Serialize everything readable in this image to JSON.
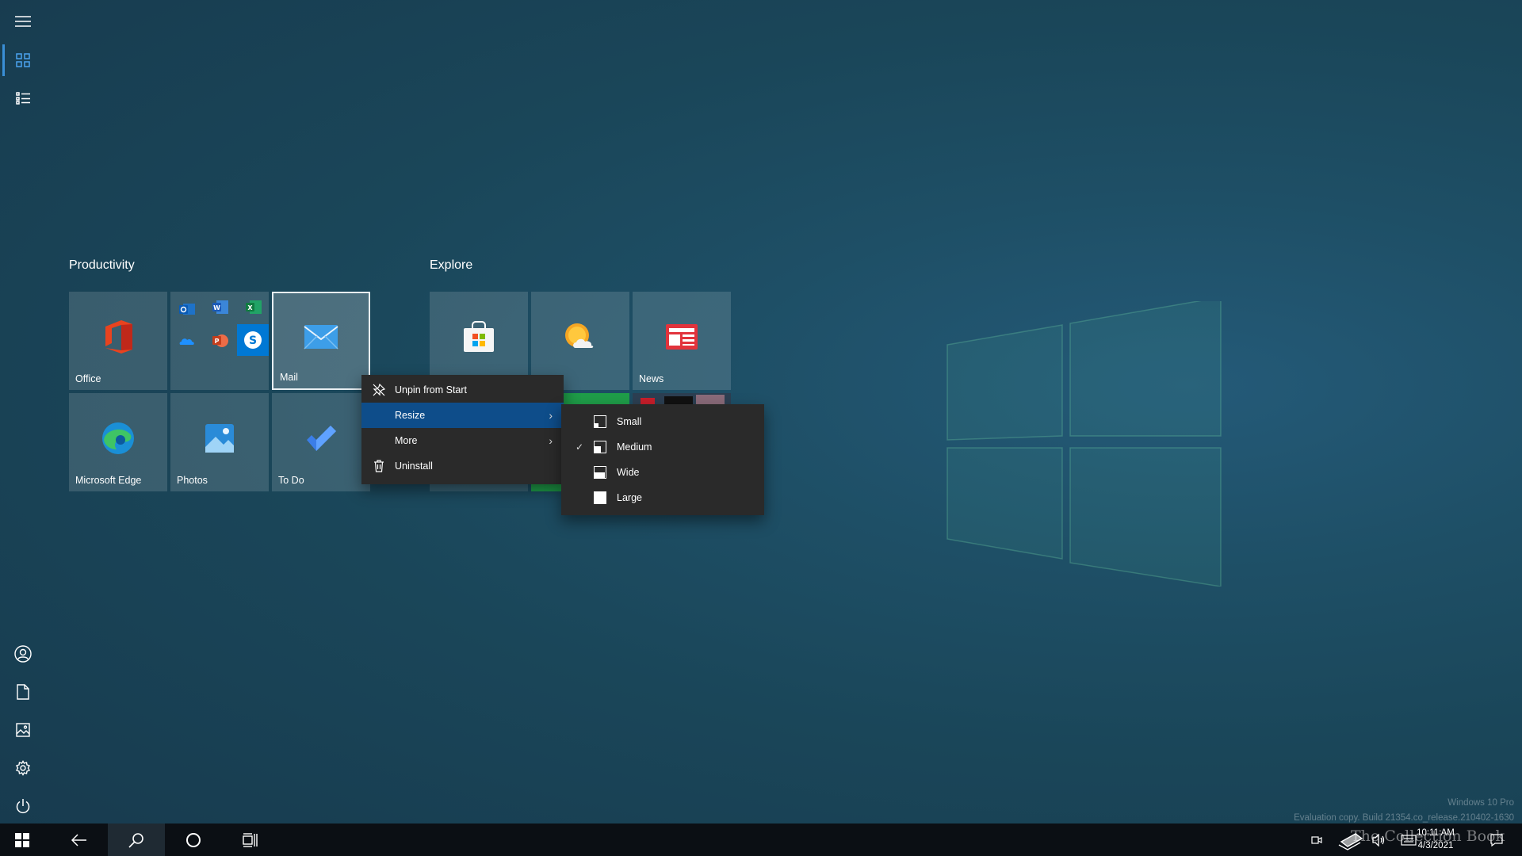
{
  "start": {
    "groups": [
      {
        "title": "Productivity",
        "tiles": [
          {
            "label": "Office",
            "icon": "office-icon"
          },
          {
            "label": "",
            "icon": "office-apps-folder-icon"
          },
          {
            "label": "Mail",
            "icon": "mail-icon"
          },
          {
            "label": "Microsoft Edge",
            "icon": "edge-icon"
          },
          {
            "label": "Photos",
            "icon": "photos-icon"
          },
          {
            "label": "To Do",
            "icon": "todo-icon"
          }
        ]
      },
      {
        "title": "Explore",
        "tiles": [
          {
            "label": "",
            "icon": "store-icon"
          },
          {
            "label": "er",
            "icon": "weather-icon"
          },
          {
            "label": "News",
            "icon": "news-icon"
          }
        ]
      }
    ]
  },
  "context_menu": {
    "items": [
      {
        "label": "Unpin from Start",
        "icon": "unpin-icon"
      },
      {
        "label": "Resize",
        "icon": "",
        "has_submenu": true,
        "highlighted": true
      },
      {
        "label": "More",
        "icon": "",
        "has_submenu": true
      },
      {
        "label": "Uninstall",
        "icon": "trash-icon"
      }
    ]
  },
  "resize_submenu": {
    "items": [
      {
        "label": "Small",
        "checked": false
      },
      {
        "label": "Medium",
        "checked": true
      },
      {
        "label": "Wide",
        "checked": false
      },
      {
        "label": "Large",
        "checked": false
      }
    ]
  },
  "taskbar": {
    "clock_time": "10:11 AM",
    "clock_date": "4/3/2021"
  },
  "watermark": {
    "line1": "Windows 10 Pro",
    "line2": "Evaluation copy. Build 21354.co_release.210402-1630"
  },
  "brand_overlay": "The Collection Book",
  "colors": {
    "accent": "#0e4d8a",
    "rail_active": "#3a8fd6",
    "menu_bg": "#2a2a2a",
    "taskbar_bg": "#0b0f14"
  }
}
